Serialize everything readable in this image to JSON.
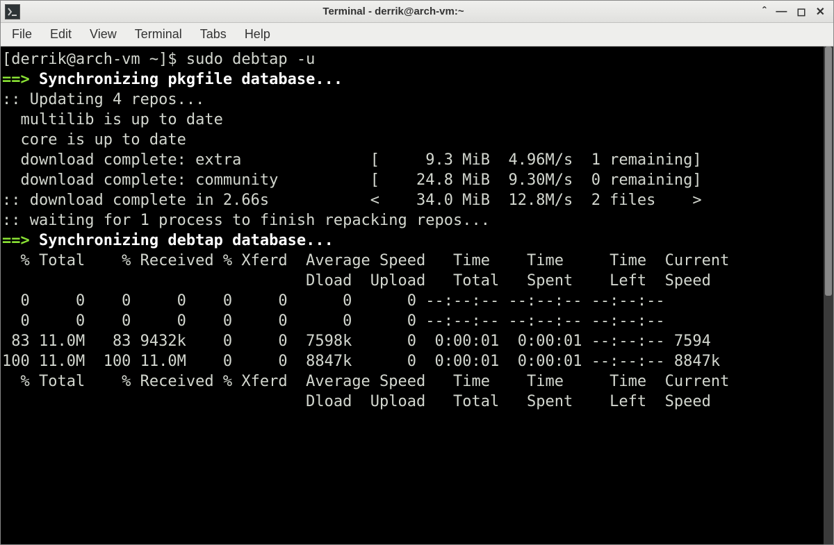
{
  "window": {
    "title": "Terminal - derrik@arch-vm:~"
  },
  "menubar": {
    "items": [
      "File",
      "Edit",
      "View",
      "Terminal",
      "Tabs",
      "Help"
    ]
  },
  "terminal": {
    "prompt": {
      "user_host": "[derrik@arch-vm ~]$ ",
      "command": "sudo debtap -u"
    },
    "arrow": "==> ",
    "sync_pkgfile": "Synchronizing pkgfile database...",
    "updating": ":: Updating 4 repos...",
    "multilib": "  multilib is up to date",
    "core": "  core is up to date",
    "dl_extra": "  download complete: extra              [     9.3 MiB  4.96M/s  1 remaining]",
    "dl_community": "  download complete: community          [    24.8 MiB  9.30M/s  0 remaining]",
    "dl_complete": ":: download complete in 2.66s           <    34.0 MiB  12.8M/s  2 files    >",
    "waiting": ":: waiting for 1 process to finish repacking repos...",
    "sync_debtap": "Synchronizing debtap database...",
    "curl_header1": "  % Total    % Received % Xferd  Average Speed   Time    Time     Time  Current",
    "curl_header2": "                                 Dload  Upload   Total   Spent    Left  Speed",
    "curl_rows": [
      "  0     0    0     0    0     0      0      0 --:--:-- --:--:-- --:--:--",
      "  0     0    0     0    0     0      0      0 --:--:-- --:--:-- --:--:--",
      " 83 11.0M   83 9432k    0     0  7598k      0  0:00:01  0:00:01 --:--:-- 7594",
      "100 11.0M  100 11.0M    0     0  8847k      0  0:00:01  0:00:01 --:--:-- 8847k"
    ],
    "curl_header1b": "  % Total    % Received % Xferd  Average Speed   Time    Time     Time  Current",
    "curl_header2b": "                                 Dload  Upload   Total   Spent    Left  Speed"
  }
}
